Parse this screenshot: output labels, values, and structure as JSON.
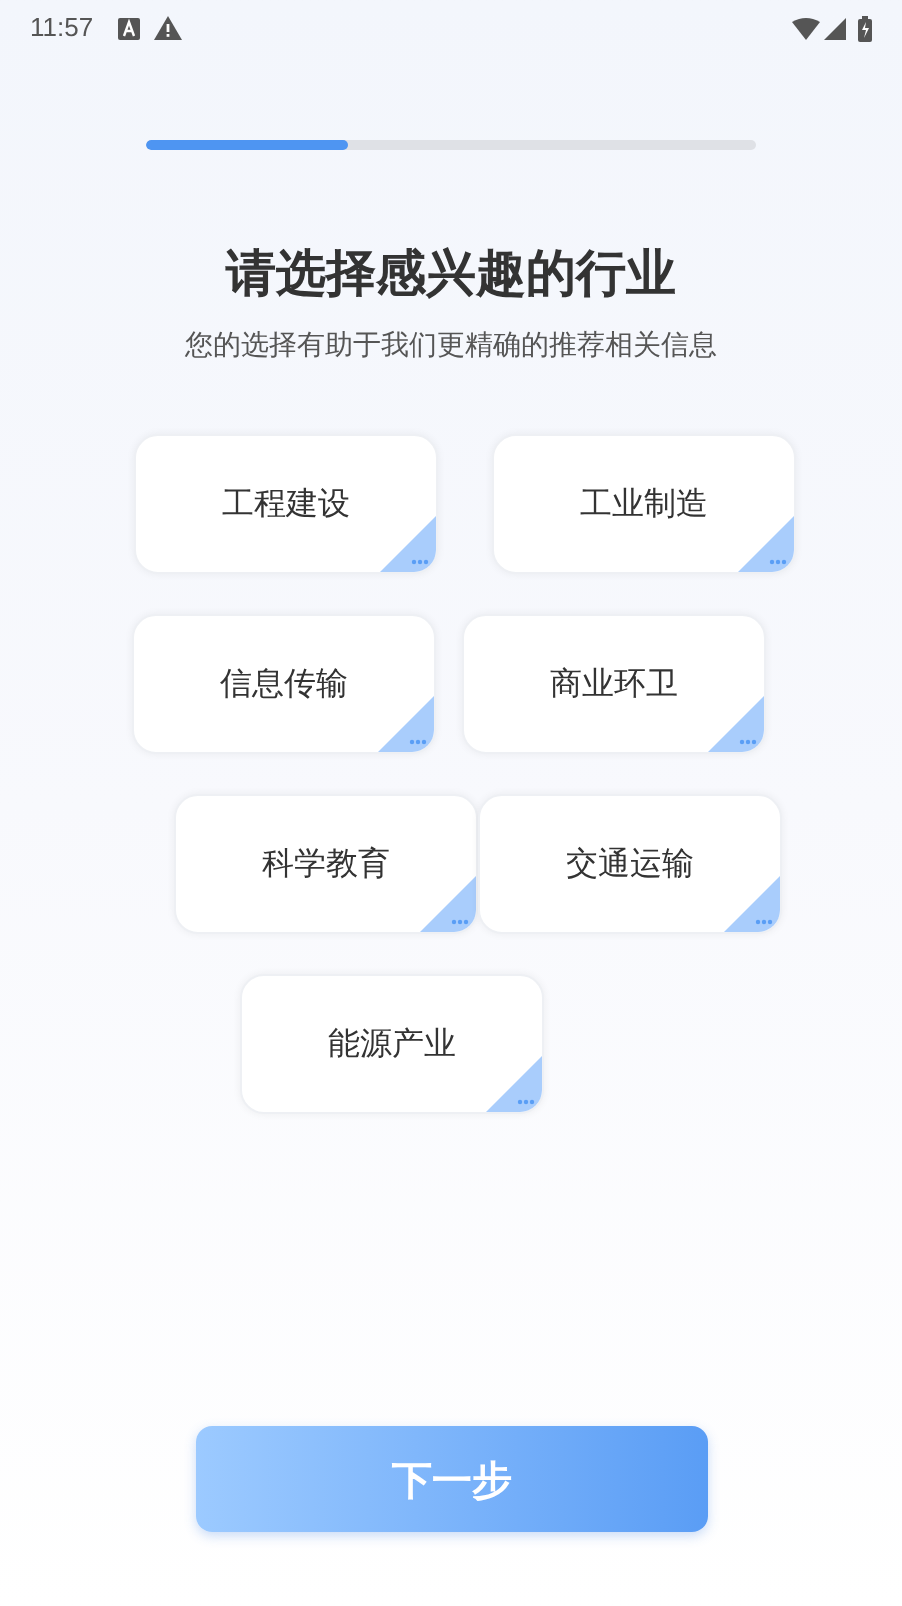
{
  "status_bar": {
    "time": "11:57"
  },
  "progress": {
    "level": 0.33
  },
  "title": "请选择感兴趣的行业",
  "subtitle": "您的选择有助于我们更精确的推荐相关信息",
  "industry_rows": [
    [
      {
        "label": "工程建设",
        "selected": false
      },
      {
        "label": "工业制造",
        "selected": false
      }
    ],
    [
      {
        "label": "信息传输",
        "selected": false
      },
      {
        "label": "商业环卫",
        "selected": false
      }
    ],
    [
      {
        "label": "科学教育",
        "selected": false
      },
      {
        "label": "交通运输",
        "selected": false
      }
    ],
    [
      {
        "label": "能源产业",
        "selected": false
      }
    ]
  ],
  "next_button": "下一步"
}
